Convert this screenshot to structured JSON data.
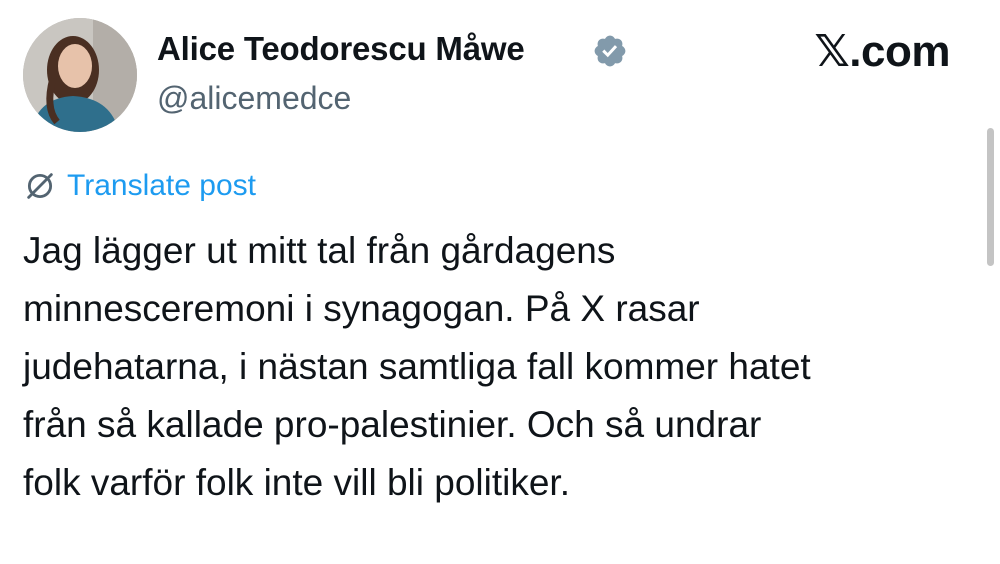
{
  "author": {
    "display_name": "Alice Teodorescu Måwe",
    "handle": "@alicemedce",
    "verified": true
  },
  "site": {
    "logo_text": "𝕏.com"
  },
  "translate": {
    "label": "Translate post",
    "icon": "globe-icon"
  },
  "post": {
    "text": "Jag lägger ut mitt tal från gårdagens\nminnesceremoni i synagogan. På X rasar\njudehatarna, i nästan samtliga fall kommer hatet\nfrån så kallade pro-palestinier. Och så undrar\nfolk varför folk inte vill bli politiker."
  },
  "colors": {
    "link": "#1d9bf0",
    "handle": "#536471",
    "text": "#0f1419",
    "verified_badge": "#829aab"
  }
}
